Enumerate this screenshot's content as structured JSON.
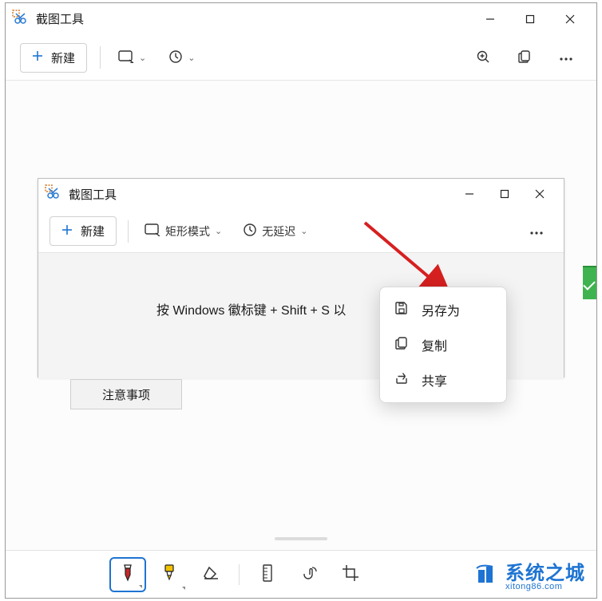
{
  "outer": {
    "title": "截图工具",
    "new_label": "新建"
  },
  "inner": {
    "title": "截图工具",
    "new_label": "新建",
    "mode_label": "矩形模式",
    "delay_label": "无延迟",
    "hint": "按 Windows 徽标键 + Shift + S 以"
  },
  "notes_chip": "注意事项",
  "popup": {
    "save_as": "另存为",
    "copy": "复制",
    "share": "共享"
  },
  "watermark": {
    "title": "系统之城",
    "url": "xitong86.com"
  },
  "icons": {
    "app": "snip-app-icon",
    "plus": "plus-icon",
    "shape": "rectangle-icon",
    "timer": "clock-icon",
    "zoom": "zoom-icon",
    "copy": "copy-icon",
    "more": "more-icon",
    "min": "minimize-icon",
    "max": "maximize-icon",
    "close": "close-icon",
    "save": "save-icon",
    "share": "share-icon",
    "pen": "pen-icon",
    "highlighter": "highlighter-icon",
    "eraser": "eraser-icon",
    "ruler": "ruler-icon",
    "touch": "touch-write-icon",
    "crop": "crop-icon"
  },
  "colors": {
    "accent": "#1e74d2",
    "pen_red": "#c62828",
    "highlighter_yellow": "#f2c200"
  }
}
